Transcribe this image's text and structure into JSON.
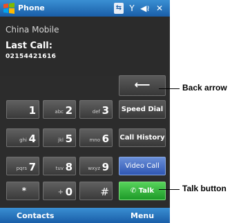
{
  "titlebar": {
    "title": "Phone",
    "icons": [
      "start-logo",
      "connectivity-icon",
      "signal-icon",
      "volume-icon",
      "close-icon"
    ]
  },
  "display": {
    "carrier": "China Mobile",
    "last_call_label": "Last Call:",
    "last_call_number": "02154421616"
  },
  "keypad": {
    "keys": [
      {
        "sub": "",
        "main": "1"
      },
      {
        "sub": "abc",
        "main": "2"
      },
      {
        "sub": "def",
        "main": "3"
      },
      {
        "sub": "ghi",
        "main": "4"
      },
      {
        "sub": "jkl",
        "main": "5"
      },
      {
        "sub": "mno",
        "main": "6"
      },
      {
        "sub": "pqrs",
        "main": "7"
      },
      {
        "sub": "tuv",
        "main": "8"
      },
      {
        "sub": "wxyz",
        "main": "9"
      },
      {
        "sub": "",
        "main": "*"
      },
      {
        "sub": "+",
        "main": "0"
      },
      {
        "sub": "",
        "main": "#"
      }
    ],
    "backspace_glyph": "⟵",
    "speed_dial": "Speed Dial",
    "call_history": "Call History",
    "video_call": "Video Call",
    "talk": "Talk"
  },
  "softkeys": {
    "left": "Contacts",
    "right": "Menu"
  },
  "annotations": {
    "back_arrow": "Back arrow",
    "talk_button": "Talk button"
  },
  "colors": {
    "titlebar": "#1a5ea8",
    "talk": "#2aa532",
    "video_call": "#3a62c0",
    "screen_bg": "#2c2c2c"
  }
}
